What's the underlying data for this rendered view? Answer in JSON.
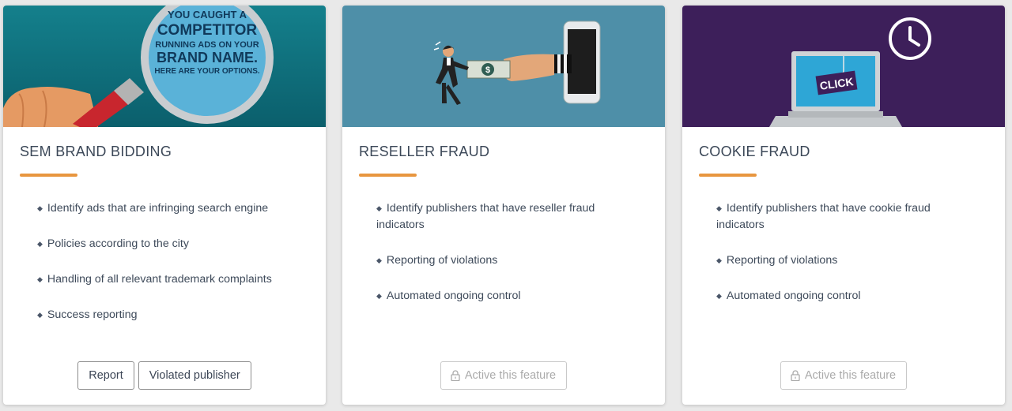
{
  "cards": [
    {
      "banner": {
        "line1": "YOU CAUGHT A",
        "line2": "COMPETITOR",
        "line3": "RUNNING ADS ON YOUR",
        "line4": "BRAND NAME.",
        "line5": "HERE ARE YOUR OPTIONS.",
        "bg": "#0f6f7c"
      },
      "title": "SEM BRAND BIDDING",
      "features": [
        "Identify ads that are infringing search engine",
        "Policies according to the city",
        "Handling of all relevant trademark complaints",
        "Success reporting"
      ],
      "buttons": [
        {
          "label": "Report"
        },
        {
          "label": "Violated publisher"
        }
      ]
    },
    {
      "banner": {
        "bg": "#4e8fa8",
        "icon": "reseller-fraud-illustration"
      },
      "title": "RESELLER FRAUD",
      "features": [
        "Identify publishers that have reseller fraud indicators",
        "Reporting of violations",
        "Automated ongoing control"
      ],
      "buttons": [
        {
          "label": "Active this feature",
          "icon": "lock-icon",
          "disabled": true
        }
      ]
    },
    {
      "banner": {
        "bg": "#3d1f5a",
        "click_text": "CLICK",
        "icon": "cookie-fraud-illustration"
      },
      "title": "COOKIE FRAUD",
      "features": [
        "Identify publishers that have cookie fraud indicators",
        "Reporting of violations",
        "Automated ongoing control"
      ],
      "buttons": [
        {
          "label": "Active this feature",
          "icon": "lock-icon",
          "disabled": true
        }
      ]
    }
  ],
  "colors": {
    "accent": "#e8963f",
    "text": "#3e4a5a",
    "disabled": "#aaaaaa"
  }
}
